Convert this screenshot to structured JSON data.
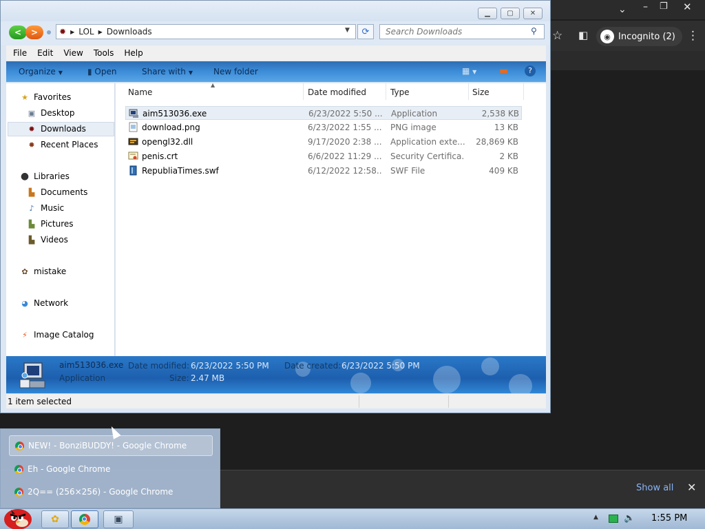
{
  "chrome": {
    "incognito_label": "Incognito (2)",
    "show_all": "Show all"
  },
  "explorer": {
    "breadcrumb": [
      "LOL",
      "Downloads"
    ],
    "search_placeholder": "Search Downloads",
    "menu": [
      "File",
      "Edit",
      "View",
      "Tools",
      "Help"
    ],
    "toolbar": {
      "organize": "Organize",
      "open": "Open",
      "share": "Share with",
      "new_folder": "New folder"
    },
    "nav": {
      "favorites": "Favorites",
      "desktop": "Desktop",
      "downloads": "Downloads",
      "recent": "Recent Places",
      "libraries": "Libraries",
      "documents": "Documents",
      "music": "Music",
      "pictures": "Pictures",
      "videos": "Videos",
      "mistake": "mistake",
      "network": "Network",
      "image_catalog": "Image Catalog"
    },
    "columns": {
      "name": "Name",
      "date": "Date modified",
      "type": "Type",
      "size": "Size"
    },
    "files": [
      {
        "name": "aim513036.exe",
        "date": "6/23/2022 5:50 ...",
        "type": "Application",
        "size": "2,538 KB",
        "icon": "exe-icon"
      },
      {
        "name": "download.png",
        "date": "6/23/2022 1:55 ...",
        "type": "PNG image",
        "size": "13 KB",
        "icon": "png-icon"
      },
      {
        "name": "opengl32.dll",
        "date": "9/17/2020 2:38 ...",
        "type": "Application exte...",
        "size": "28,869 KB",
        "icon": "dll-icon"
      },
      {
        "name": "penis.crt",
        "date": "6/6/2022 11:29 ...",
        "type": "Security Certifica...",
        "size": "2 KB",
        "icon": "certificate-icon"
      },
      {
        "name": "RepubliaTimes.swf",
        "date": "6/12/2022 12:58...",
        "type": "SWF File",
        "size": "409 KB",
        "icon": "swf-icon"
      }
    ],
    "details": {
      "name": "aim513036.exe",
      "type": "Application",
      "date_modified_label": "Date modified:",
      "date_modified": "6/23/2022 5:50 PM",
      "date_created_label": "Date created:",
      "date_created": "6/23/2022 5:50 PM",
      "size_label": "Size:",
      "size": "2.47 MB"
    },
    "status": "1 item selected"
  },
  "task_list": [
    "NEW! - BonziBUDDY! - Google Chrome",
    "Eh - Google Chrome",
    "2Q== (256×256) - Google Chrome"
  ],
  "clock": "1:55 PM"
}
